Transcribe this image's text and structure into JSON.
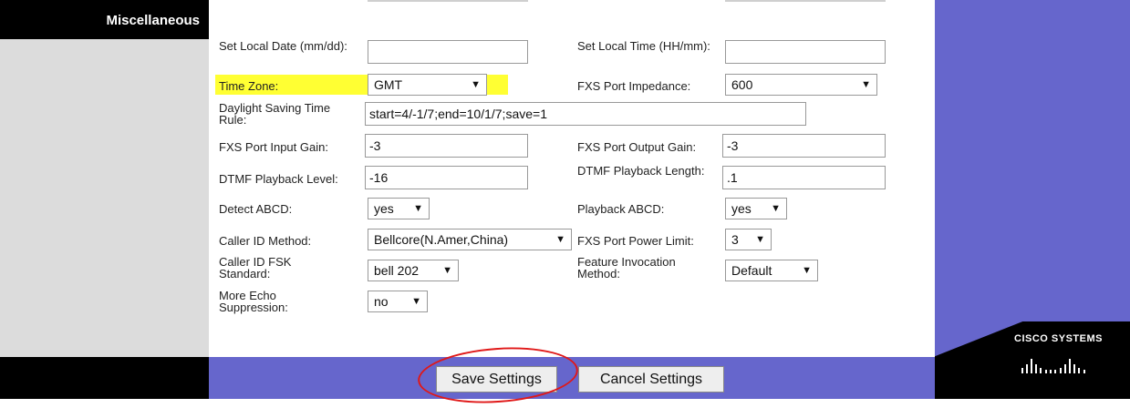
{
  "section": {
    "title": "Miscellaneous"
  },
  "brand": {
    "name": "Cisco Systems"
  },
  "fields": {
    "set_local_date": {
      "label": "Set Local Date (mm/dd):",
      "value": ""
    },
    "set_local_time": {
      "label": "Set Local Time (HH/mm):",
      "value": ""
    },
    "time_zone": {
      "label": "Time Zone:",
      "value": "GMT"
    },
    "fxs_port_impedance": {
      "label": "FXS Port Impedance:",
      "value": "600"
    },
    "daylight_saving": {
      "label": "Daylight Saving Time Rule:",
      "value": "start=4/-1/7;end=10/1/7;save=1"
    },
    "fxs_input_gain": {
      "label": "FXS Port Input Gain:",
      "value": "-3"
    },
    "fxs_output_gain": {
      "label": "FXS Port Output Gain:",
      "value": "-3"
    },
    "dtmf_level": {
      "label": "DTMF Playback Level:",
      "value": "-16"
    },
    "dtmf_length": {
      "label": "DTMF Playback Length:",
      "value": ".1"
    },
    "detect_abcd": {
      "label": "Detect ABCD:",
      "value": "yes"
    },
    "playback_abcd": {
      "label": "Playback ABCD:",
      "value": "yes"
    },
    "caller_id_method": {
      "label": "Caller ID Method:",
      "value": "Bellcore(N.Amer,China)"
    },
    "fxs_power_limit": {
      "label": "FXS Port Power Limit:",
      "value": "3"
    },
    "caller_id_fsk": {
      "label": "Caller ID FSK Standard:",
      "value": "bell 202"
    },
    "feature_invocation": {
      "label": "Feature Invocation Method:",
      "value": "Default"
    },
    "echo_suppression": {
      "label": "More Echo Suppression:",
      "value": "no"
    }
  },
  "buttons": {
    "save": "Save Settings",
    "cancel": "Cancel Settings"
  },
  "colors": {
    "accent": "#6666cc",
    "highlight": "#ffff33",
    "annotation": "#e01818"
  },
  "icons": {
    "dropdown": "dropdown-arrow-icon",
    "logo": "cisco-bars-logo"
  }
}
